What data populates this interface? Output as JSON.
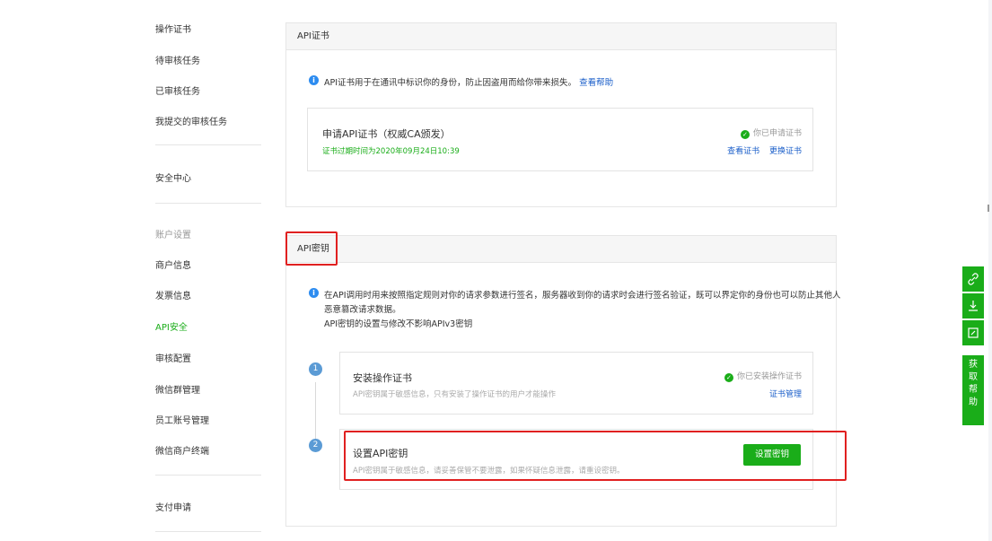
{
  "sidebar": {
    "items": [
      {
        "label": "操作证书",
        "state": "normal"
      },
      {
        "label": "待审核任务",
        "state": "normal"
      },
      {
        "label": "已审核任务",
        "state": "normal"
      },
      {
        "label": "我提交的审核任务",
        "state": "normal"
      },
      {
        "label": "安全中心",
        "state": "normal"
      },
      {
        "label": "账户设置",
        "state": "group"
      },
      {
        "label": "商户信息",
        "state": "normal"
      },
      {
        "label": "发票信息",
        "state": "normal"
      },
      {
        "label": "API安全",
        "state": "active"
      },
      {
        "label": "审核配置",
        "state": "normal"
      },
      {
        "label": "微信群管理",
        "state": "normal"
      },
      {
        "label": "员工账号管理",
        "state": "normal"
      },
      {
        "label": "微信商户终端",
        "state": "normal"
      },
      {
        "label": "支付申请",
        "state": "normal"
      }
    ]
  },
  "api_cert": {
    "header": "API证书",
    "info_text": "API证书用于在通讯中标识你的身份，防止因盗用而给你带来损失。",
    "info_link": "查看帮助",
    "box_title": "申请API证书（权威CA颁发）",
    "box_sub": "证书过期时间为2020年09月24日10:39",
    "status": "你已申请证书",
    "action_view": "查看证书",
    "action_replace": "更换证书"
  },
  "api_key": {
    "header": "API密钥",
    "info_line1": "在API调用时用来按照指定规则对你的请求参数进行签名，服务器收到你的请求时会进行签名验证，既可以界定你的身份也可以防止其他人",
    "info_line2": "恶意篡改请求数据。",
    "info_line3": "API密钥的设置与修改不影响APIv3密钥",
    "step1": {
      "number": "1",
      "title": "安装操作证书",
      "sub": "API密钥属于敏感信息，只有安装了操作证书的用户才能操作",
      "status": "你已安装操作证书",
      "action": "证书管理"
    },
    "step2": {
      "number": "2",
      "title": "设置API密钥",
      "sub": "API密钥属于敏感信息，请妥善保管不要泄露，如果怀疑信息泄露，请重设密钥。",
      "button": "设置密钥"
    }
  },
  "float_bar": {
    "icons": [
      "link-icon",
      "download-icon",
      "edit-icon"
    ],
    "help": [
      "获",
      "取",
      "帮",
      "助"
    ]
  },
  "colors": {
    "accent_green": "#1aad19",
    "highlight_red": "#e02020",
    "info_blue": "#2d8cf0",
    "link_blue": "#1a5ec9"
  }
}
